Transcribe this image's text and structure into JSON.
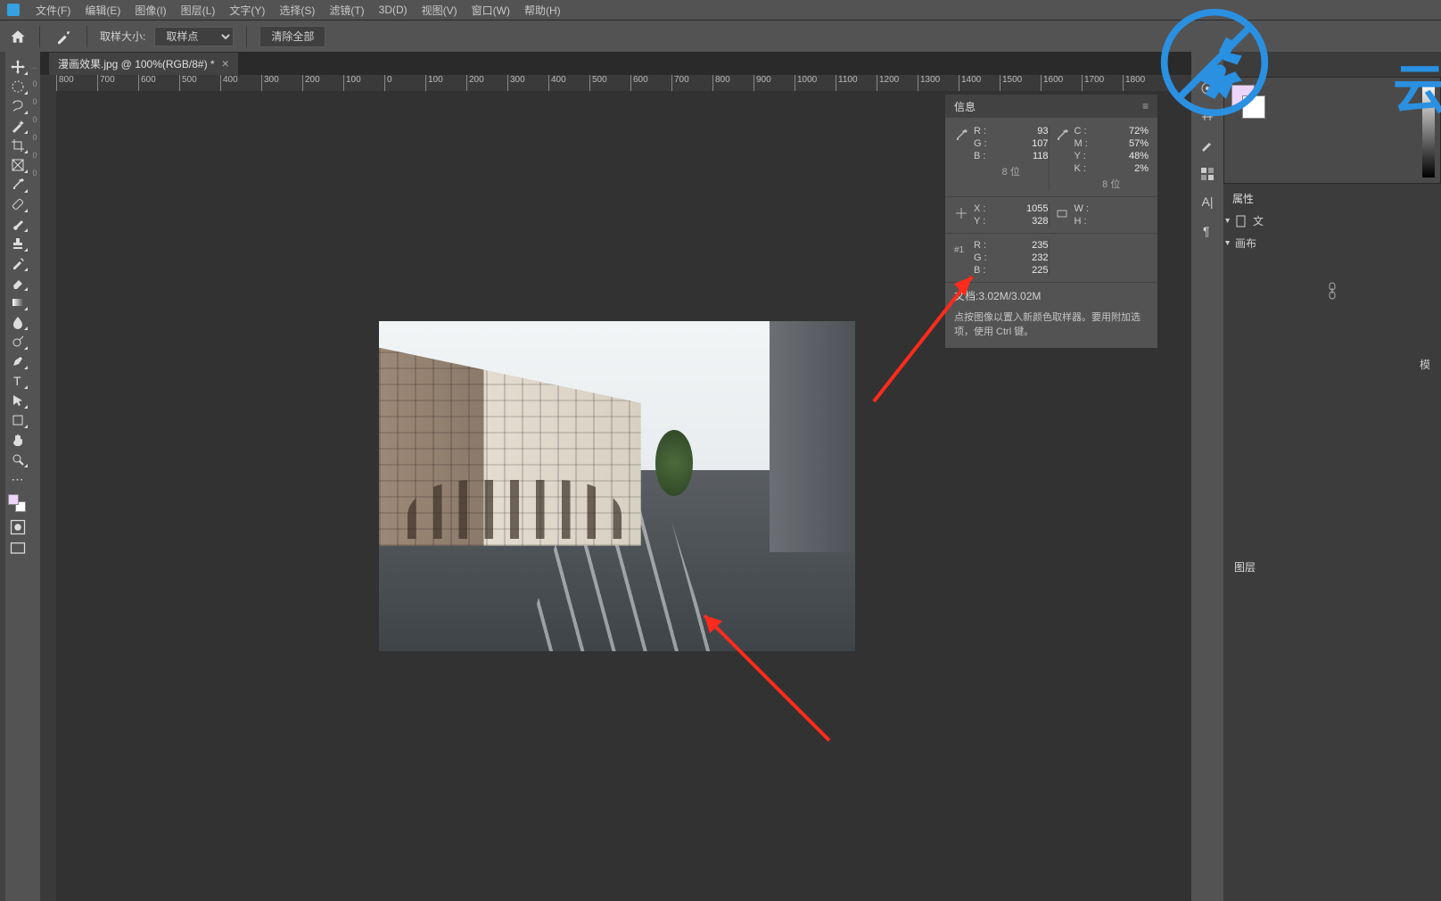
{
  "menu": {
    "items": [
      "文件(F)",
      "编辑(E)",
      "图像(I)",
      "图层(L)",
      "文字(Y)",
      "选择(S)",
      "滤镜(T)",
      "3D(D)",
      "视图(V)",
      "窗口(W)",
      "帮助(H)"
    ]
  },
  "options": {
    "sample_size_label": "取样大小:",
    "sample_size_value": "取样点",
    "clear_all": "清除全部"
  },
  "document": {
    "tab_title": "漫画效果.jpg @ 100%(RGB/8#) *"
  },
  "ruler": {
    "ticks": [
      "800",
      "700",
      "600",
      "500",
      "400",
      "300",
      "200",
      "100",
      "0",
      "100",
      "200",
      "300",
      "400",
      "500",
      "600",
      "700",
      "800",
      "900",
      "1000",
      "1100",
      "1200",
      "1300",
      "1400",
      "1500",
      "1600",
      "1700",
      "1800"
    ]
  },
  "info_panel": {
    "title": "信息",
    "rgb": {
      "R": "93",
      "G": "107",
      "B": "118",
      "bits": "8 位"
    },
    "cmyk": {
      "C": "72%",
      "M": "57%",
      "Y": "48%",
      "K": "2%",
      "bits": "8 位"
    },
    "pos": {
      "X": "1055",
      "Y": "328"
    },
    "size": {
      "W": "",
      "H": ""
    },
    "sample1": {
      "label": "#1",
      "R": "235",
      "G": "232",
      "B": "225"
    },
    "doc_label": "文档:",
    "doc_value": "3.02M/3.02M",
    "hint": "点按图像以置入新颜色取样器。要用附加选项，使用 Ctrl 键。"
  },
  "right_panels": {
    "properties": "属性",
    "doc_label": "文",
    "canvas_label": "画布",
    "mode_label": "模",
    "layers": "图层"
  }
}
